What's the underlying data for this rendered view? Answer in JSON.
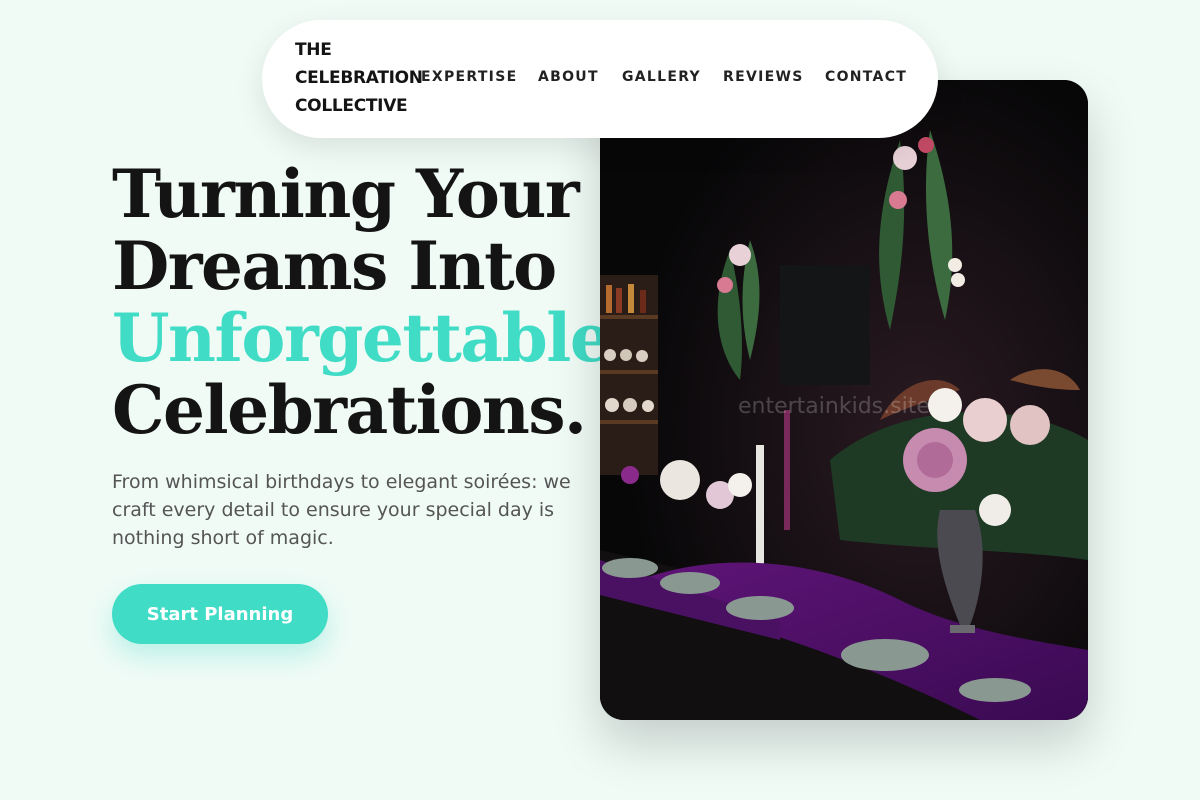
{
  "brand": {
    "line1": "THE",
    "line2": "CELEBRATION",
    "line3": "COLLECTIVE"
  },
  "nav": {
    "links": [
      "EXPERTISE",
      "ABOUT",
      "GALLERY",
      "REVIEWS",
      "CONTACT"
    ]
  },
  "hero": {
    "headline_line1": "Turning Your",
    "headline_line2": "Dreams Into",
    "headline_accent": "Unforgettable",
    "headline_line4": "Celebrations.",
    "subtext": "From whimsical birthdays to elegant soirées: we craft every detail to ensure your special day is nothing short of magic.",
    "cta_label": "Start Planning"
  },
  "photo": {
    "watermark": "entertainkids.site"
  },
  "colors": {
    "background": "#f0fbf6",
    "accent": "#40dcc6",
    "text": "#141414",
    "muted": "#555555"
  }
}
